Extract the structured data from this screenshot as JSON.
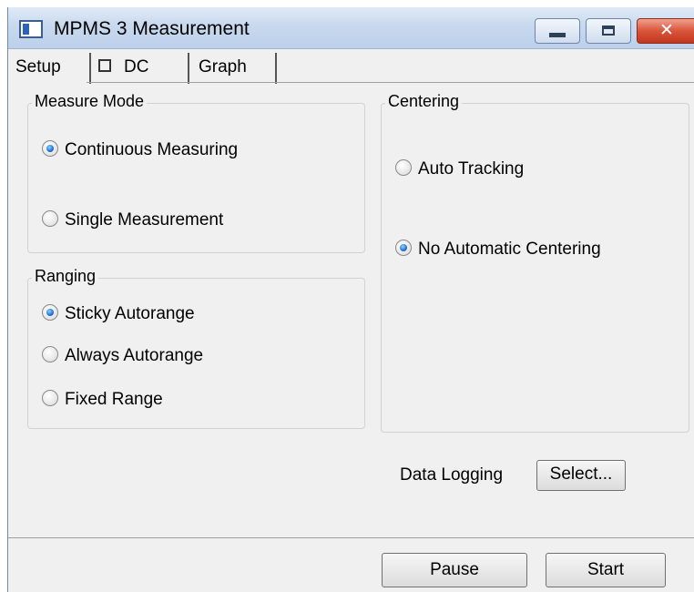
{
  "window": {
    "title": "MPMS 3 Measurement"
  },
  "tabs": [
    {
      "label": "Setup"
    },
    {
      "label": "DC"
    },
    {
      "label": "Graph"
    }
  ],
  "measure_mode": {
    "label": "Measure Mode",
    "options": [
      {
        "label": "Continuous Measuring",
        "selected": true
      },
      {
        "label": "Single Measurement",
        "selected": false
      }
    ]
  },
  "ranging": {
    "label": "Ranging",
    "options": [
      {
        "label": "Sticky Autorange",
        "selected": true
      },
      {
        "label": "Always Autorange",
        "selected": false
      },
      {
        "label": "Fixed Range",
        "selected": false
      }
    ]
  },
  "centering": {
    "label": "Centering",
    "options": [
      {
        "label": "Auto Tracking",
        "selected": false
      },
      {
        "label": "No Automatic Centering",
        "selected": true
      }
    ]
  },
  "data_logging": {
    "label": "Data Logging",
    "button": "Select..."
  },
  "footer": {
    "pause": "Pause",
    "start": "Start"
  }
}
